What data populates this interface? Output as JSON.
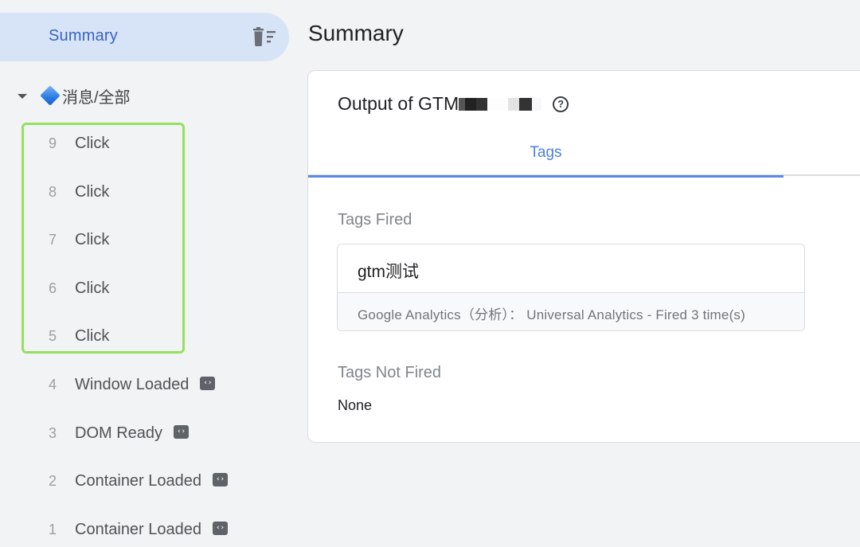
{
  "sidebar": {
    "summary_label": "Summary",
    "clear_icon": "trash-list-icon",
    "group": {
      "label": "消息/全部",
      "expand_icon": "caret-down-icon",
      "badge_icon": "blue-diamond-icon"
    },
    "events": [
      {
        "num": "9",
        "name": "Click",
        "has_code_badge": false,
        "highlighted": true
      },
      {
        "num": "8",
        "name": "Click",
        "has_code_badge": false,
        "highlighted": true
      },
      {
        "num": "7",
        "name": "Click",
        "has_code_badge": false,
        "highlighted": true
      },
      {
        "num": "6",
        "name": "Click",
        "has_code_badge": false,
        "highlighted": true
      },
      {
        "num": "5",
        "name": "Click",
        "has_code_badge": false,
        "highlighted": true
      },
      {
        "num": "4",
        "name": "Window Loaded",
        "has_code_badge": true,
        "highlighted": false
      },
      {
        "num": "3",
        "name": "DOM Ready",
        "has_code_badge": true,
        "highlighted": false
      },
      {
        "num": "2",
        "name": "Container Loaded",
        "has_code_badge": true,
        "highlighted": false
      },
      {
        "num": "1",
        "name": "Container Loaded",
        "has_code_badge": true,
        "highlighted": false
      }
    ],
    "code_badge_glyph": "‹›",
    "highlight_color": "#95e05c"
  },
  "main": {
    "page_title": "Summary",
    "card": {
      "title_prefix": "Output of GTM",
      "help_glyph": "?",
      "tabs": [
        {
          "label": "Tags",
          "active": true
        }
      ],
      "tags_fired_label": "Tags Fired",
      "tags_fired": [
        {
          "name": "gtm测试",
          "meta": "Google Analytics（分析）： Universal Analytics - Fired 3 time(s)"
        }
      ],
      "tags_not_fired_label": "Tags Not Fired",
      "tags_not_fired_value": "None"
    }
  },
  "colors": {
    "accent": "#4a7fe0",
    "selected_bg": "#d7e3f7",
    "background": "#f1f3f4"
  }
}
